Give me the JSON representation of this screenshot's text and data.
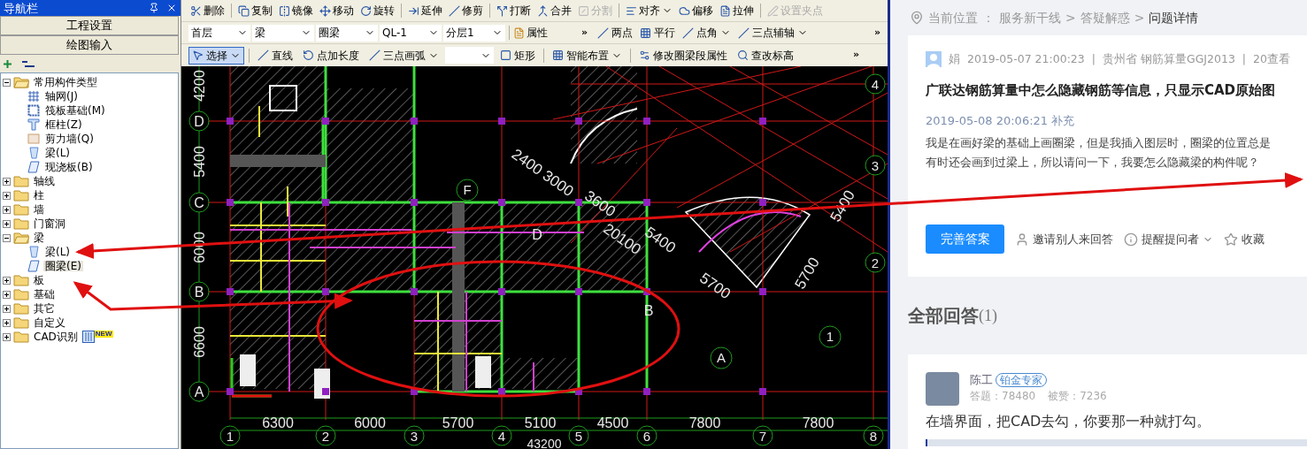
{
  "nav_panel": {
    "title": "导航栏",
    "buttons": [
      "工程设置",
      "绘图输入"
    ],
    "tree": [
      {
        "label": "常用构件类型",
        "expanded": true,
        "selected": false,
        "children": [
          {
            "label": "轴网(J)",
            "kind": "grid",
            "selected": false
          },
          {
            "label": "筏板基础(M)",
            "kind": "raft",
            "selected": false
          },
          {
            "label": "框柱(Z)",
            "kind": "column",
            "selected": false
          },
          {
            "label": "剪力墙(Q)",
            "kind": "wall",
            "selected": false
          },
          {
            "label": "梁(L)",
            "kind": "beam",
            "selected": false
          },
          {
            "label": "现浇板(B)",
            "kind": "slab",
            "selected": false
          }
        ]
      },
      {
        "label": "轴线",
        "expanded": false,
        "selected": false
      },
      {
        "label": "柱",
        "expanded": false,
        "selected": false
      },
      {
        "label": "墙",
        "expanded": false,
        "selected": false
      },
      {
        "label": "门窗洞",
        "expanded": false,
        "selected": false
      },
      {
        "label": "梁",
        "expanded": true,
        "selected": false,
        "children": [
          {
            "label": "梁(L)",
            "kind": "beam",
            "selected": false
          },
          {
            "label": "圈梁(E)",
            "kind": "slab",
            "selected": true
          }
        ]
      },
      {
        "label": "板",
        "expanded": false,
        "selected": false
      },
      {
        "label": "基础",
        "expanded": false,
        "selected": false
      },
      {
        "label": "其它",
        "expanded": false,
        "selected": false
      },
      {
        "label": "自定义",
        "expanded": false,
        "selected": false
      },
      {
        "label": "CAD识别",
        "expanded": false,
        "selected": false,
        "badge": "NEW"
      }
    ]
  },
  "toolbar_edit": [
    {
      "label": "删除",
      "disabled": false,
      "dropdown": false
    },
    {
      "label": "复制",
      "disabled": false,
      "dropdown": false
    },
    {
      "label": "镜像",
      "disabled": false,
      "dropdown": false
    },
    {
      "label": "移动",
      "disabled": false,
      "dropdown": false
    },
    {
      "label": "旋转",
      "disabled": false,
      "dropdown": false
    },
    {
      "label": "延伸",
      "disabled": false,
      "dropdown": false
    },
    {
      "label": "修剪",
      "disabled": false,
      "dropdown": false
    },
    {
      "label": "打断",
      "disabled": false,
      "dropdown": false
    },
    {
      "label": "合并",
      "disabled": false,
      "dropdown": false
    },
    {
      "label": "分割",
      "disabled": true,
      "dropdown": false
    },
    {
      "label": "对齐",
      "disabled": false,
      "dropdown": true
    },
    {
      "label": "偏移",
      "disabled": false,
      "dropdown": false
    },
    {
      "label": "拉伸",
      "disabled": false,
      "dropdown": false
    },
    {
      "label": "设置夹点",
      "disabled": true,
      "dropdown": false
    }
  ],
  "selectors": [
    "首层",
    "梁",
    "圈梁",
    "QL-1",
    "分层1"
  ],
  "properties_button": "属性",
  "overflow_mark": "»",
  "toolbar_axis": [
    {
      "label": "两点",
      "dropdown": false
    },
    {
      "label": "平行",
      "dropdown": false
    },
    {
      "label": "点角",
      "dropdown": true
    },
    {
      "label": "三点辅轴",
      "dropdown": true
    }
  ],
  "toolbar_draw": [
    {
      "label": "选择",
      "kind": "button",
      "selected": true,
      "dropdown": true
    },
    {
      "label": "直线",
      "kind": "button",
      "selected": false,
      "dropdown": false
    },
    {
      "label": "点加长度",
      "kind": "button",
      "selected": false,
      "dropdown": false
    },
    {
      "label": "三点画弧",
      "kind": "button",
      "selected": false,
      "dropdown": true
    },
    {
      "kind": "select"
    },
    {
      "label": "矩形",
      "kind": "button",
      "selected": false,
      "dropdown": false
    },
    {
      "label": "智能布置",
      "kind": "button",
      "selected": false,
      "dropdown": true
    },
    {
      "label": "修改圈梁段属性",
      "kind": "button",
      "selected": false,
      "dropdown": false
    },
    {
      "label": "查改标高",
      "kind": "button",
      "selected": false,
      "dropdown": false
    }
  ],
  "canvas": {
    "bottom_dims": [
      "6300",
      "6000",
      "5700",
      "5100",
      "4500",
      "7800",
      "7800"
    ],
    "total_dim": "43200",
    "x_axes": [
      "1",
      "2",
      "3",
      "4",
      "5",
      "6",
      "7",
      "8"
    ],
    "left_dims": [
      "4200",
      "5400",
      "6000",
      "6600"
    ],
    "y_axes": [
      "D",
      "C",
      "B",
      "A"
    ],
    "right_axes": [
      "4",
      "3",
      "2"
    ],
    "inner_labels": [
      {
        "text": "2400 3000",
        "kind": "dim"
      },
      {
        "text": "3600",
        "kind": "dim"
      },
      {
        "text": "20100",
        "kind": "dim"
      },
      {
        "text": "5400",
        "kind": "dim"
      },
      {
        "text": "5700",
        "kind": "dim"
      },
      {
        "text": "5700",
        "kind": "dim2"
      },
      {
        "text": "5400",
        "kind": "dim2"
      },
      {
        "text": "1",
        "kind": "bubble"
      },
      {
        "text": "A",
        "kind": "bubble"
      },
      {
        "text": "F",
        "kind": "bubble"
      },
      {
        "text": "D",
        "kind": "plain"
      },
      {
        "text": "B",
        "kind": "plain"
      }
    ]
  },
  "qa_page": {
    "breadcrumb": {
      "label": "当前位置",
      "colon": "：",
      "separator": ">",
      "items": [
        "服务新干线",
        "答疑解惑",
        "问题详情"
      ]
    },
    "question": {
      "author": "娟",
      "time": "2019-05-07 21:00:23",
      "divider": "|",
      "region": "贵州省",
      "product": "钢筋算量GGJ2013",
      "views": "20查看",
      "title": "广联达钢筋算量中怎么隐藏钢筋等信息，只显示CAD原始图",
      "supplement": "2019-05-08 20:06:21 补充",
      "body": [
        "我是在画好梁的基础上画圈梁，但是我插入图层时，圈梁的位置总是",
        "有时还会画到过梁上，所以请问一下，我要怎么隐藏梁的构件呢？"
      ],
      "primary_action": "完善答案",
      "actions": [
        {
          "label": "邀请别人来回答",
          "kind": "invite",
          "dropdown": false
        },
        {
          "label": "提醒提问者",
          "kind": "remind",
          "dropdown": true
        },
        {
          "label": "收藏",
          "kind": "star",
          "dropdown": false
        }
      ]
    },
    "answers_heading": "全部回答",
    "answers_count": "(1)",
    "answer": {
      "name": "陈工",
      "badge": "铂金专家",
      "answers_stat": "答题：78480",
      "likes_stat": "被赞：7236",
      "text": "在墙界面，把CAD去勾，你要那一种就打勾。"
    }
  }
}
